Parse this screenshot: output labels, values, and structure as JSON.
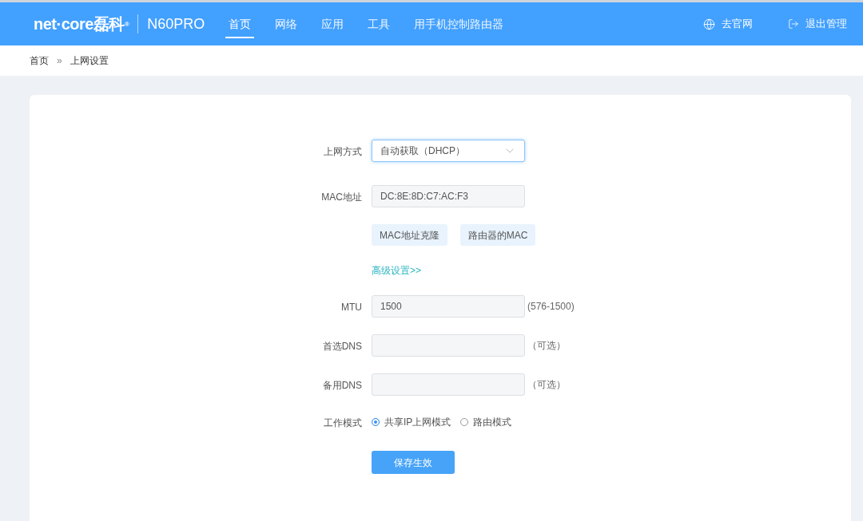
{
  "header": {
    "logo": "net·core磊科$^{®}$",
    "model": "N60PRO",
    "nav": [
      {
        "label": "首页",
        "selected": true
      },
      {
        "label": "网络",
        "selected": false
      },
      {
        "label": "应用",
        "selected": false
      },
      {
        "label": "工具",
        "selected": false
      },
      {
        "label": "用手机控制路由器",
        "selected": false
      }
    ],
    "actions": [
      {
        "kind": "website",
        "label": "去官网"
      },
      {
        "kind": "logout",
        "label": "退出管理"
      }
    ]
  },
  "breadcrumb": {
    "items": [
      "首页",
      "上网设置"
    ],
    "separator": "»"
  },
  "form": {
    "rows": [
      {
        "kind": "select",
        "label": "上网方式",
        "value": "自动获取（DHCP）",
        "focused": true
      },
      {
        "kind": "input",
        "label": "MAC地址",
        "value": "DC:8E:8D:C7:AC:F3"
      },
      {
        "kind": "buttons",
        "buttons": [
          "MAC地址克隆",
          "路由器的MAC"
        ]
      },
      {
        "kind": "link",
        "text": "高级设置>>"
      },
      {
        "kind": "input",
        "label": "MTU",
        "value": "1500",
        "hint": "(576-1500)"
      },
      {
        "kind": "input",
        "label": "首选DNS",
        "hint": "（可选）"
      },
      {
        "kind": "input",
        "label": "备用DNS",
        "hint": "（可选）"
      },
      {
        "kind": "radio",
        "label": "工作模式",
        "options": [
          {
            "label": "共享IP上网模式",
            "selected": true
          },
          {
            "label": "路由模式",
            "selected": false
          }
        ]
      },
      {
        "kind": "submit",
        "label": "保存生效"
      }
    ]
  }
}
